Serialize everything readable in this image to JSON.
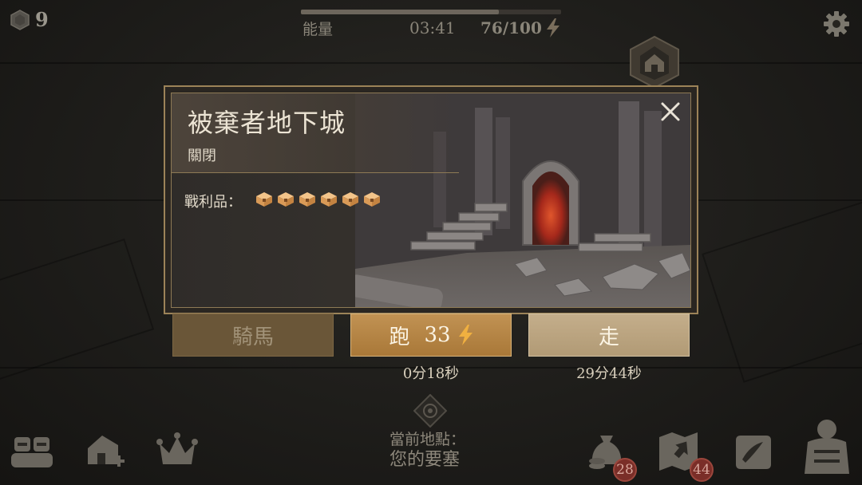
{
  "top_bar": {
    "gem_count": "9",
    "energy_label": "能量",
    "energy_timer": "03:41",
    "energy_value": "76/100",
    "energy_fraction": 0.76
  },
  "dialog": {
    "title": "被棄者地下城",
    "status": "關閉",
    "loot_label": "戰利品：",
    "loot_count": 6
  },
  "travel": {
    "horse_label": "騎馬",
    "run_label": "跑",
    "run_cost": "33",
    "walk_label": "走",
    "run_time": "0分18秒",
    "walk_time": "29分44秒"
  },
  "location": {
    "label": "當前地點：",
    "value": "您的要塞"
  },
  "bottom_bar": {
    "bag_badge": "28",
    "map_badge": "44"
  },
  "colors": {
    "accent": "#c19253",
    "bolt": "#e0a63f",
    "badge": "#7a2e28"
  },
  "icons": [
    "gem-icon",
    "bolt-icon",
    "gear-icon",
    "house-marker-icon",
    "close-icon",
    "chest-icon",
    "location-marker-icon",
    "team-icon",
    "add-building-icon",
    "crown-icon",
    "money-bag-icon",
    "map-icon",
    "quest-scroll-icon",
    "character-icon"
  ]
}
